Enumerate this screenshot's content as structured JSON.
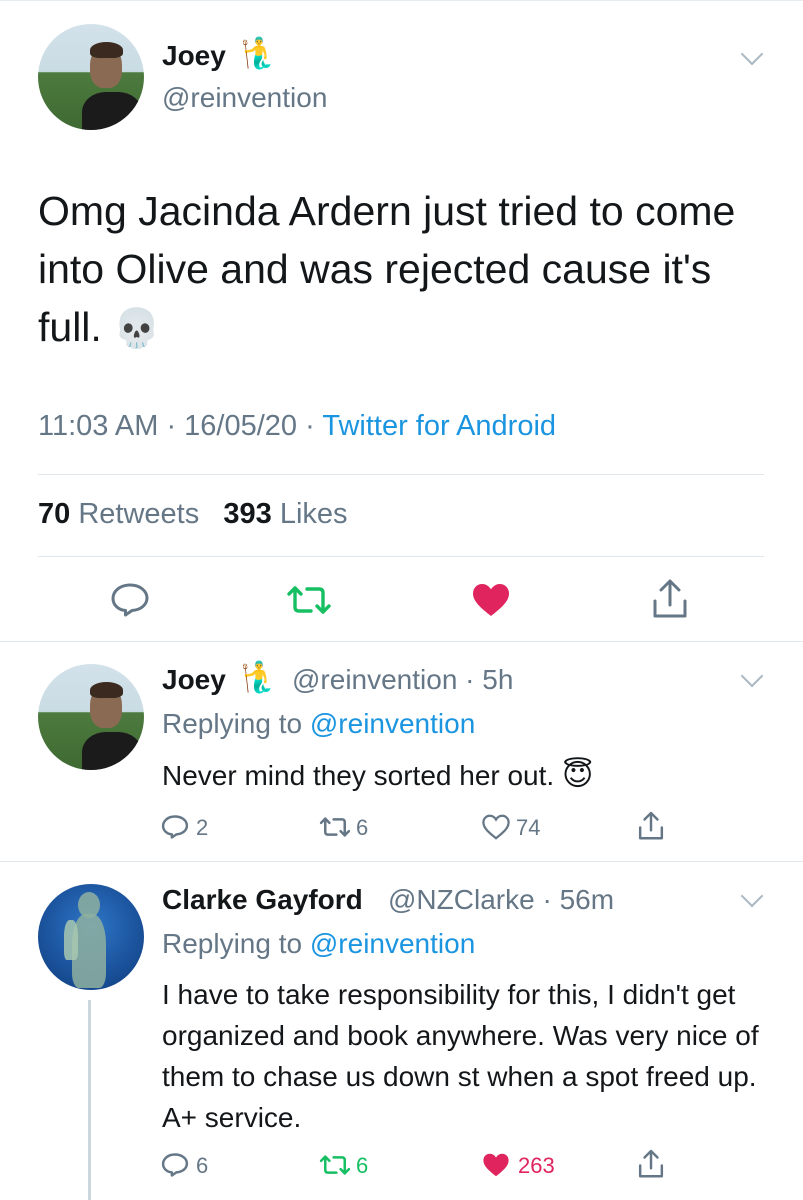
{
  "main_tweet": {
    "author_name": "Joey",
    "author_emoji": "🧜‍♂️",
    "author_handle": "@reinvention",
    "text": "Omg Jacinda Ardern just tried to come into Olive and was rejected cause it's full.",
    "text_emoji": "💀",
    "time": "11:03 AM",
    "date": "16/05/20",
    "source": "Twitter for Android",
    "retweets_count": "70",
    "retweets_label": "Retweets",
    "likes_count": "393",
    "likes_label": "Likes",
    "liked": true,
    "retweeted": true
  },
  "replies": [
    {
      "author_name": "Joey",
      "author_emoji": "🧜‍♂️",
      "author_handle": "@reinvention",
      "age": "5h",
      "replying_prefix": "Replying to",
      "replying_to": "@reinvention",
      "text": "Never mind they sorted her out.",
      "text_emoji": "😇",
      "reply_count": "2",
      "retweet_count": "6",
      "like_count": "74",
      "liked": false
    },
    {
      "author_name": "Clarke Gayford",
      "author_handle": "@NZClarke",
      "age": "56m",
      "replying_prefix": "Replying to",
      "replying_to": "@reinvention",
      "text": "I have to take responsibility for this, I didn't get organized and book anywhere. Was very nice of them to chase us down st when a spot freed up. A+ service.",
      "reply_count": "6",
      "retweet_count": "6",
      "like_count": "263",
      "liked": true,
      "retweeted": true
    }
  ],
  "colors": {
    "text": "#14171a",
    "secondary": "#657786",
    "link": "#1b95e0",
    "retweet_green": "#17bf63",
    "like_red": "#e0245e"
  }
}
